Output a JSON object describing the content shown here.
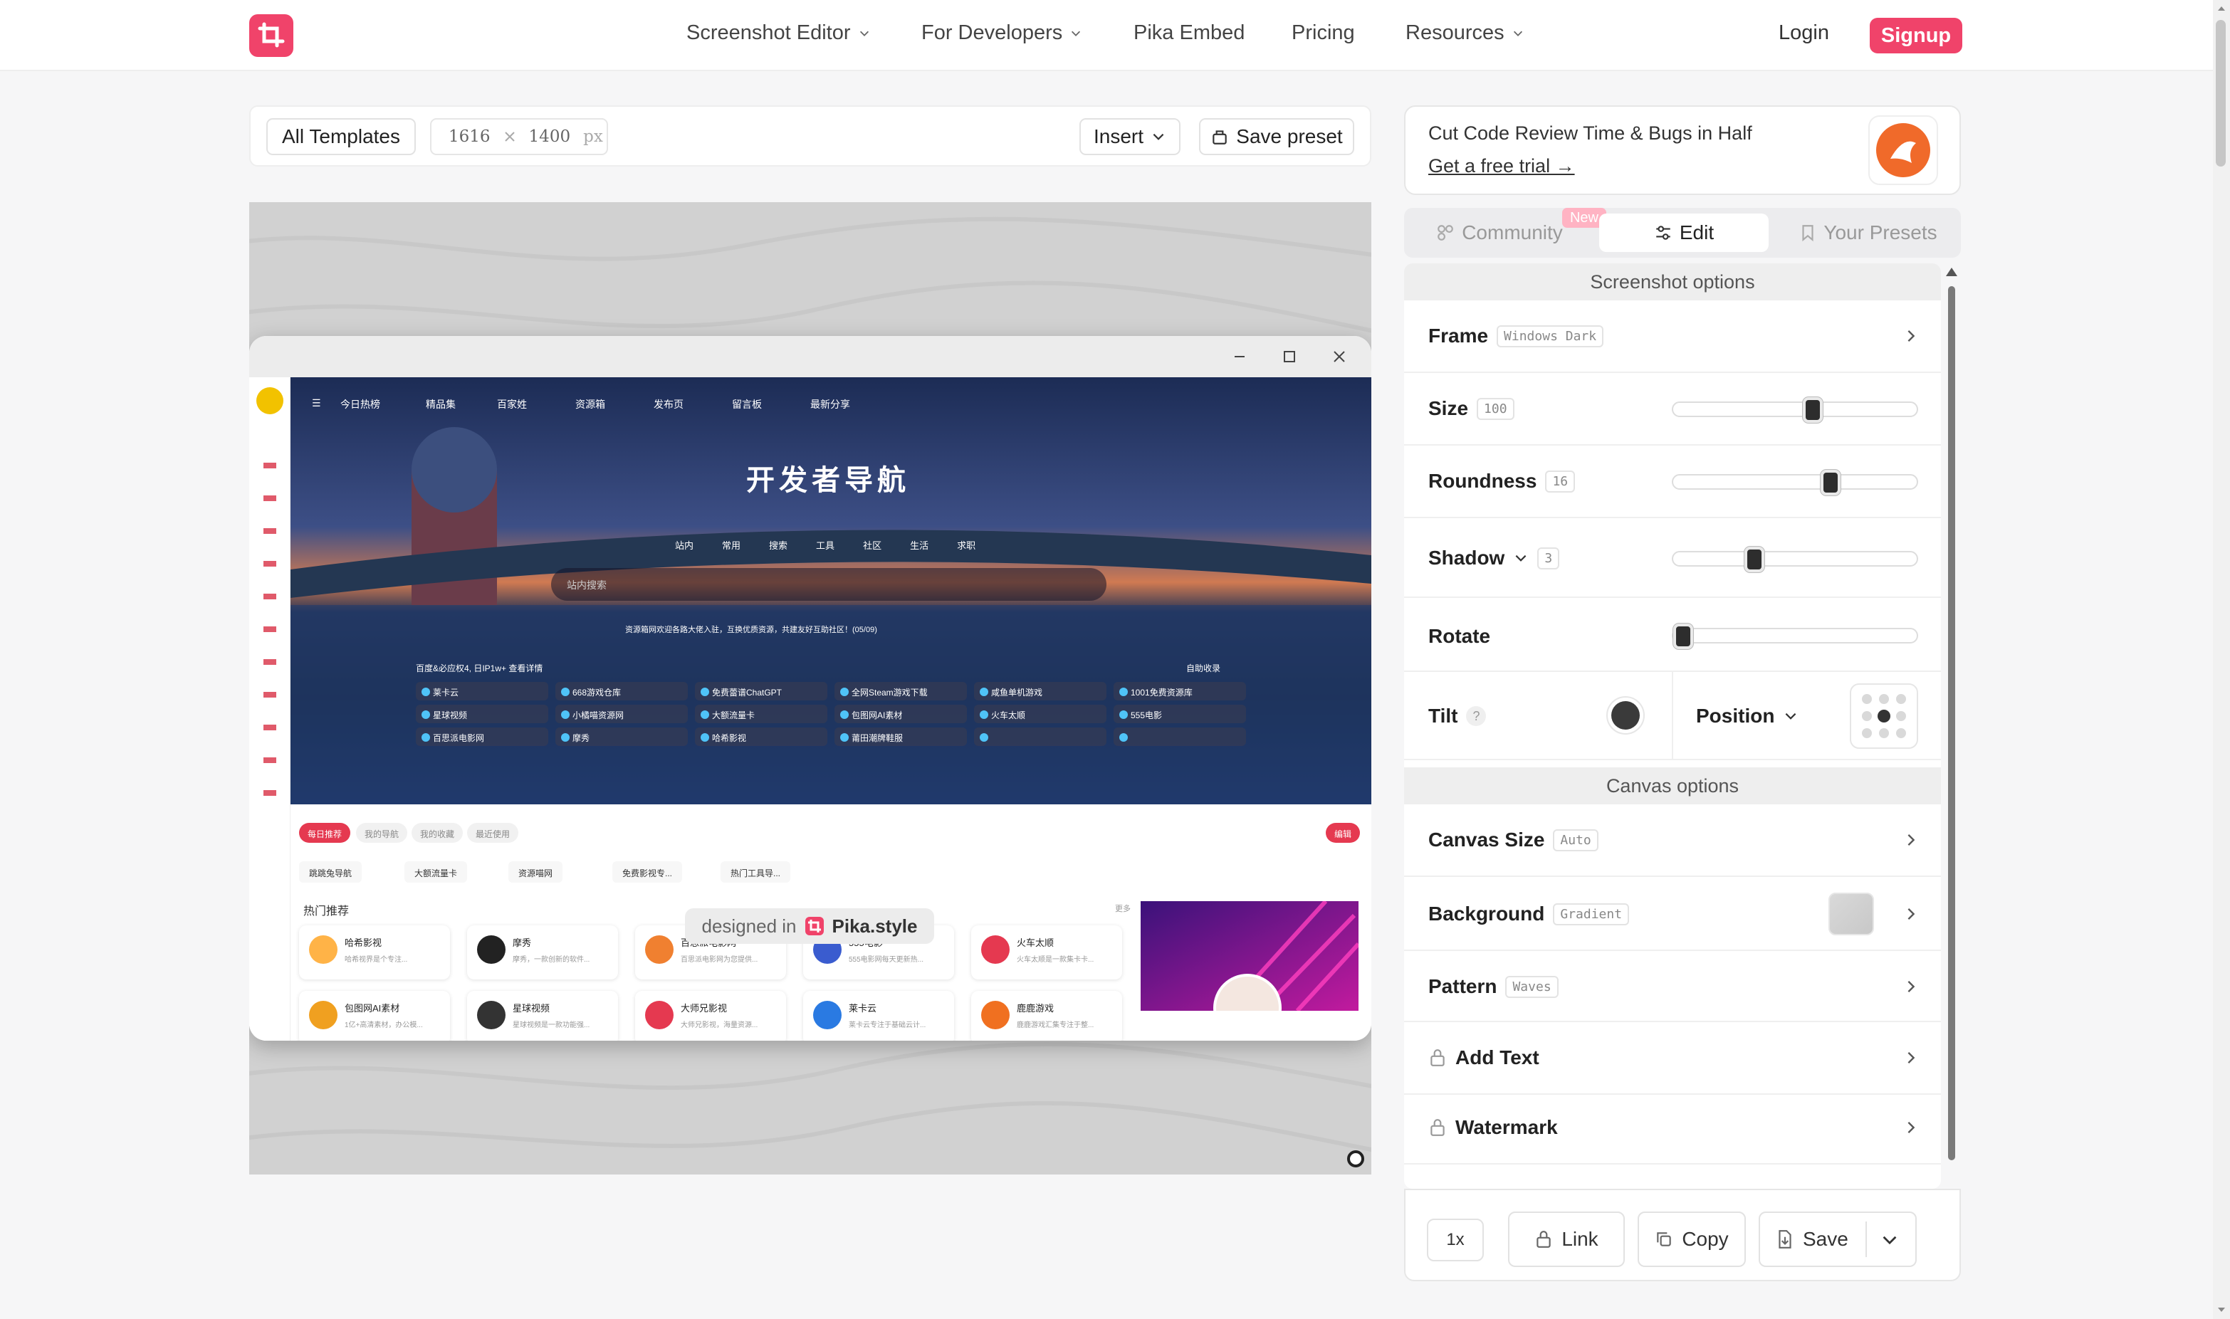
{
  "nav": {
    "items": [
      {
        "label": "Screenshot Editor",
        "dropdown": true
      },
      {
        "label": "For Developers",
        "dropdown": true
      },
      {
        "label": "Pika Embed",
        "dropdown": false
      },
      {
        "label": "Pricing",
        "dropdown": false
      },
      {
        "label": "Resources",
        "dropdown": true
      }
    ],
    "login": "Login",
    "signup": "Signup"
  },
  "toolbar": {
    "templates": "All Templates",
    "width": "1616",
    "height": "1400",
    "unit": "px",
    "insert": "Insert",
    "save_preset": "Save preset"
  },
  "canvas": {
    "credit_prefix": "designed in",
    "credit_brand": "Pika.style",
    "window_frame": "Windows Dark",
    "site": {
      "title": "开发者导航",
      "menu": [
        "今日热榜",
        "精品集",
        "百家姓",
        "资源箱",
        "发布页",
        "留言板",
        "最新分享"
      ],
      "search_tabs": [
        "站内",
        "常用",
        "搜索",
        "工具",
        "社区",
        "生活",
        "求职"
      ],
      "search_placeholder": "站内搜索",
      "notice": "资源箱网欢迎各路大佬入驻，互换优质资源，共建友好互助社区！(05/09)",
      "links_header": "百度&必应权4, 日IP1w+ 查看详情",
      "links_action": "自助收录",
      "links": [
        "莱卡云",
        "668游戏仓库",
        "免费蕾谱ChatGPT",
        "全网Steam游戏下载",
        "咸鱼单机游戏",
        "1001免费资源库",
        "星球视频",
        "小橘喵资源网",
        "大额流量卡",
        "包图网AI素材",
        "火车太顺",
        "555电影",
        "百思派电影网",
        "摩秀",
        "哈希影视",
        "莆田潮牌鞋服",
        "",
        ""
      ],
      "tabs": [
        "每日推荐",
        "我的导航",
        "我的收藏",
        "最近使用"
      ],
      "tabs_action": "编辑",
      "quick_links": [
        "跳跳兔导航",
        "大额流量卡",
        "资源喵网",
        "免费影视专...",
        "热门工具导..."
      ],
      "hot_title": "热门推荐",
      "hot_more": "更多",
      "cards": [
        {
          "name": "哈希影视",
          "desc": "哈希视界是个专注..."
        },
        {
          "name": "摩秀",
          "desc": "摩秀，一款创新的软件..."
        },
        {
          "name": "百思派电影网",
          "desc": "百思派电影网为您提供..."
        },
        {
          "name": "555电影",
          "desc": "555电影网每天更新热..."
        },
        {
          "name": "火车太顺",
          "desc": "火车太顺是一款集卡卡..."
        },
        {
          "name": "包图网AI素材",
          "desc": "1亿+高清素材，办公模..."
        },
        {
          "name": "星球视频",
          "desc": "星球视频是一款功能强..."
        },
        {
          "name": "大师兄影视",
          "desc": "大师兄影视，海量资源..."
        },
        {
          "name": "莱卡云",
          "desc": "莱卡云专注于基础云计..."
        },
        {
          "name": "鹿鹿游戏",
          "desc": "鹿鹿游戏汇集专注于整..."
        }
      ]
    }
  },
  "ad": {
    "text": "Cut Code Review Time & Bugs in Half",
    "link": "Get a free trial →"
  },
  "panel_tabs": {
    "community": "Community",
    "new_badge": "New",
    "edit": "Edit",
    "presets": "Your Presets"
  },
  "screenshot_options": {
    "header": "Screenshot options",
    "frame": {
      "label": "Frame",
      "value": "Windows Dark"
    },
    "size": {
      "label": "Size",
      "value": "100",
      "level": 0.58
    },
    "roundness": {
      "label": "Roundness",
      "value": "16",
      "level": 0.66
    },
    "shadow": {
      "label": "Shadow",
      "value": "3",
      "level": 0.32
    },
    "rotate": {
      "label": "Rotate",
      "level": 0.0
    },
    "tilt": {
      "label": "Tilt",
      "help": "?"
    },
    "position": {
      "label": "Position",
      "selected": "center"
    }
  },
  "canvas_options": {
    "header": "Canvas options",
    "canvas_size": {
      "label": "Canvas Size",
      "value": "Auto"
    },
    "background": {
      "label": "Background",
      "value": "Gradient"
    },
    "pattern": {
      "label": "Pattern",
      "value": "Waves"
    },
    "add_text": {
      "label": "Add Text"
    },
    "watermark": {
      "label": "Watermark"
    }
  },
  "bottom": {
    "scale": "1x",
    "link": "Link",
    "copy": "Copy",
    "save": "Save"
  },
  "colors": {
    "brand": "#f0436a",
    "thumb": "#2d2d2d"
  }
}
